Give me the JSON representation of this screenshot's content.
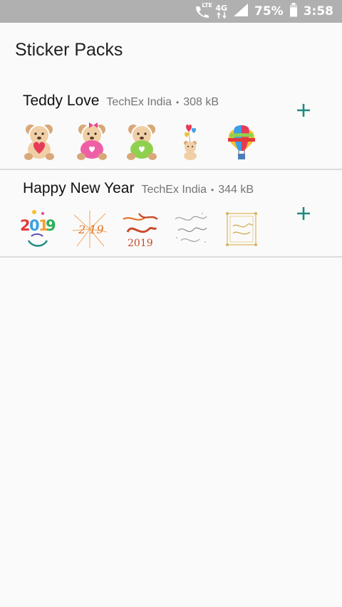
{
  "status_bar": {
    "lte": "LTE",
    "network": "4G",
    "battery": "75%",
    "time": "3:58",
    "icons": [
      "call-lte-icon",
      "4g-data-icon",
      "signal-icon",
      "battery-icon"
    ]
  },
  "app": {
    "title": "Sticker Packs",
    "accent_color": "#1f8a7d"
  },
  "packs": [
    {
      "name": "Teddy Love",
      "publisher": "TechEx India",
      "separator": "•",
      "size": "308 kB",
      "stickers": [
        "teddy-love-you-sticker",
        "teddy-pink-bow-sticker",
        "teddy-green-shirt-sticker",
        "teddy-balloons-sticker",
        "hot-air-balloon-sticker"
      ],
      "add_icon": "add-icon"
    },
    {
      "name": "Happy New Year",
      "publisher": "TechEx India",
      "separator": "•",
      "size": "344 kB",
      "stickers": [
        "happy-new-year-2019-colorful-sticker",
        "new-2019-fireworks-sticker",
        "happy-new-year-2019-orange-sticker",
        "happy-new-year-script-sticker",
        "happy-new-year-gold-frame-sticker"
      ],
      "add_icon": "add-icon"
    }
  ]
}
